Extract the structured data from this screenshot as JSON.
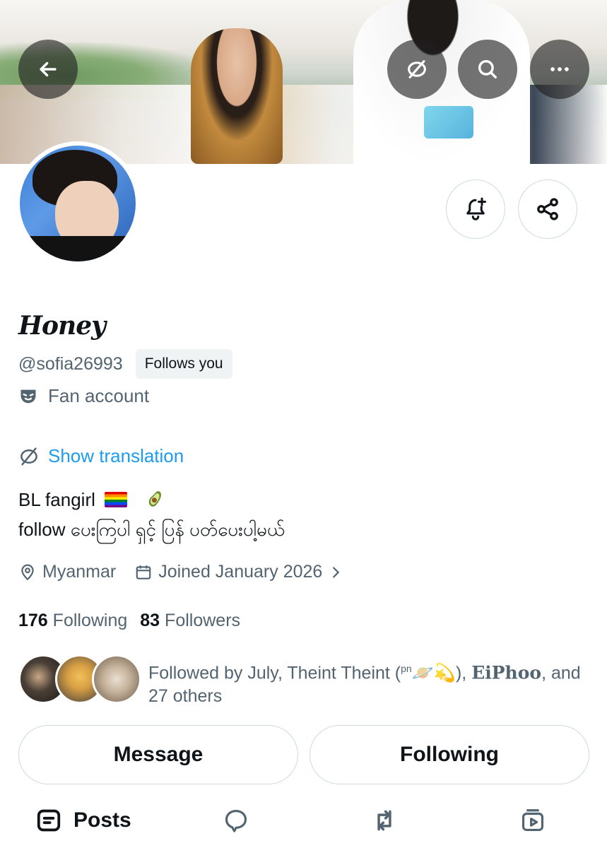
{
  "header": {
    "back_icon": "arrow-left-icon",
    "translate_icon": "translate-icon",
    "search_icon": "search-icon",
    "more_icon": "more-horizontal-icon"
  },
  "profile": {
    "display_name": "Honey",
    "handle": "@sofia26993",
    "follows_you_badge": "Follows you",
    "category": "Fan account",
    "show_translation": "Show translation",
    "bio_line1": "BL fangirl",
    "bio_line2": "follow ပေးကြပါ ရှင့် ပြန် ပတ်ပေးပါ့မယ်",
    "location": "Myanmar",
    "joined": "Joined January 2026",
    "following_count": "176",
    "following_label": "Following",
    "followers_count": "83",
    "followers_label": "Followers",
    "followed_by_prefix": "Followed by July, Theint Theint (",
    "followed_by_pn": "pn",
    "followed_by_emoji": "🪐💫",
    "followed_by_mid": "), ",
    "followed_by_bold": "EiPhoo",
    "followed_by_suffix": ", and 27 others"
  },
  "actions": {
    "notify_icon": "bell-plus-icon",
    "share_icon": "share-icon",
    "message_label": "Message",
    "following_label": "Following"
  },
  "tabs": {
    "posts_label": "Posts",
    "replies_icon": "speech-bubble-icon",
    "reposts_icon": "repost-icon",
    "media_icon": "media-icon"
  },
  "colors": {
    "link": "#1d9bf0",
    "secondary_text": "#536471",
    "border": "#cfd9de"
  }
}
